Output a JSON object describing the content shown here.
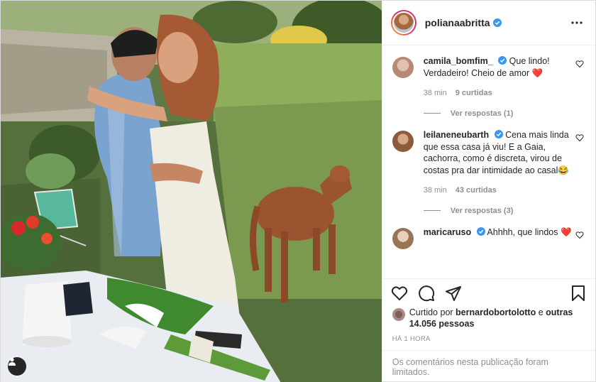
{
  "header": {
    "username": "polianaabritta",
    "more_icon": "more-horizontal-icon"
  },
  "comments": [
    {
      "username": "camila_bomfim_",
      "text": "Que lindo! Verdadeiro! Cheio de amor",
      "emoji": "❤️",
      "time": "38 min",
      "likes": "9 curtidas",
      "replies": "Ver respostas (1)",
      "avatar_color": "#b88a74"
    },
    {
      "username": "leilaneneubarth",
      "text": "Cena mais linda que essa casa já viu! E a Gaia, cachorra, como é discreta, virou de costas pra dar intimidade ao casal",
      "emoji": "😂",
      "time": "38 min",
      "likes": "43 curtidas",
      "replies": "Ver respostas (3)",
      "avatar_color": "#8e5a3c"
    },
    {
      "username": "maricaruso",
      "text": "Ahhhh, que lindos",
      "emoji": "❤️",
      "avatar_color": "#c9a98a"
    }
  ],
  "liked_by": {
    "prefix": "Curtido por",
    "user": "bernardobortolotto",
    "and": "e",
    "others": "outras 14.056 pessoas"
  },
  "posted_time": "HÁ 1 HORA",
  "comments_limited": "Os comentários nesta publicação foram limitados.",
  "colors": {
    "verified_blue": "#3897f0",
    "heart_red": "#ed4956",
    "meta_gray": "#8e8e8e"
  }
}
